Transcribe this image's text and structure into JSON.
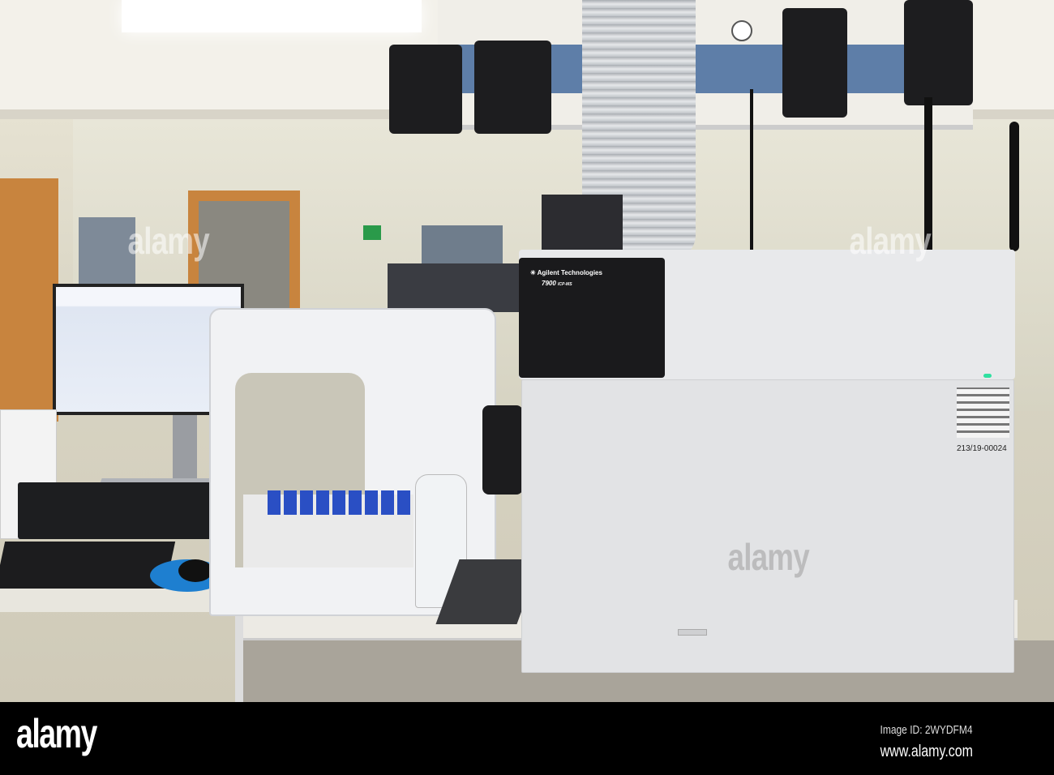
{
  "instrument": {
    "brand": "Agilent Technologies",
    "model": "7900",
    "model_sub": "ICP-MS",
    "serial_label": "213/19-00024"
  },
  "watermark": {
    "logo": "alamy",
    "image_id": "Image ID: 2WYDFM4",
    "url": "www.alamy.com"
  },
  "colors": {
    "footer": "#000000",
    "instrument_body": "#e4e5e7",
    "front_panel": "#1a1a1c",
    "vial_caps": "#2a4fc4",
    "mousepad": "#1e7fd0"
  }
}
